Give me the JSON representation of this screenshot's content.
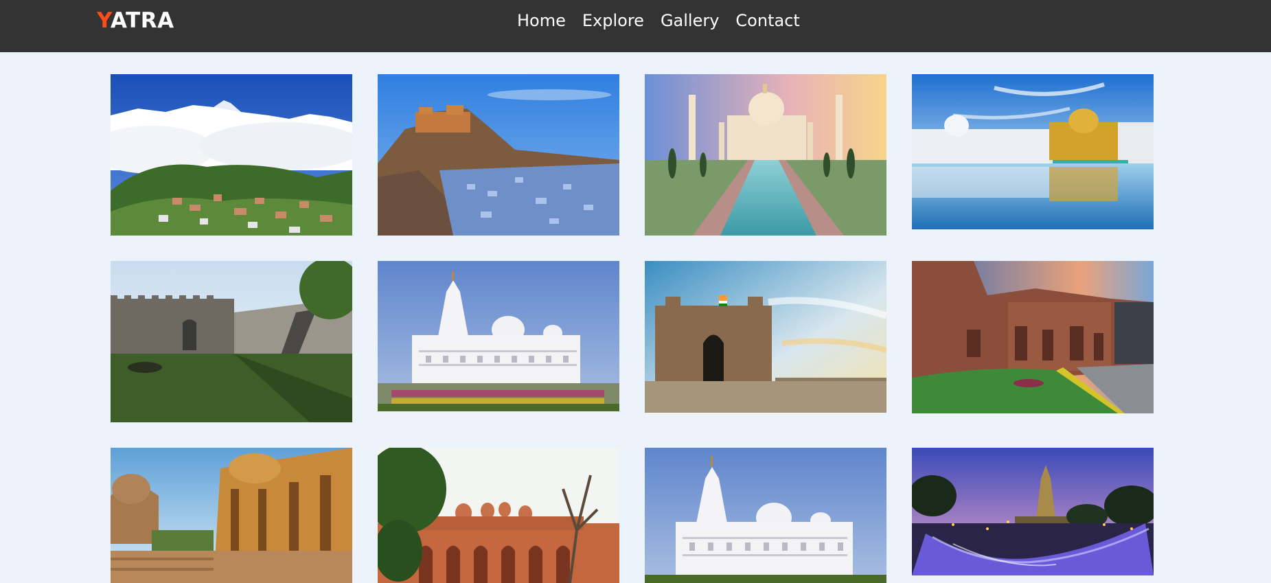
{
  "brand": {
    "first_letter": "Y",
    "rest": "ATRA",
    "accent_color": "#ff4c1a",
    "text_color": "#ffffff"
  },
  "nav": {
    "items": [
      {
        "label": "Home"
      },
      {
        "label": "Explore"
      },
      {
        "label": "Gallery"
      },
      {
        "label": "Contact"
      }
    ]
  },
  "colors": {
    "header_bg": "#333333",
    "page_bg": "#edf3fa"
  },
  "gallery": {
    "images": [
      {
        "subject": "mountain-town-snow-peaks"
      },
      {
        "subject": "hill-fort-blue-city"
      },
      {
        "subject": "taj-mahal"
      },
      {
        "subject": "golden-temple"
      },
      {
        "subject": "stone-fort-wall-lawn"
      },
      {
        "subject": "white-marble-temple"
      },
      {
        "subject": "gateway-of-india"
      },
      {
        "subject": "rock-cut-caves"
      },
      {
        "subject": "sandstone-chhatris"
      },
      {
        "subject": "red-sandstone-palace"
      },
      {
        "subject": "white-marble-temple"
      },
      {
        "subject": "illuminated-temple-night"
      }
    ]
  }
}
